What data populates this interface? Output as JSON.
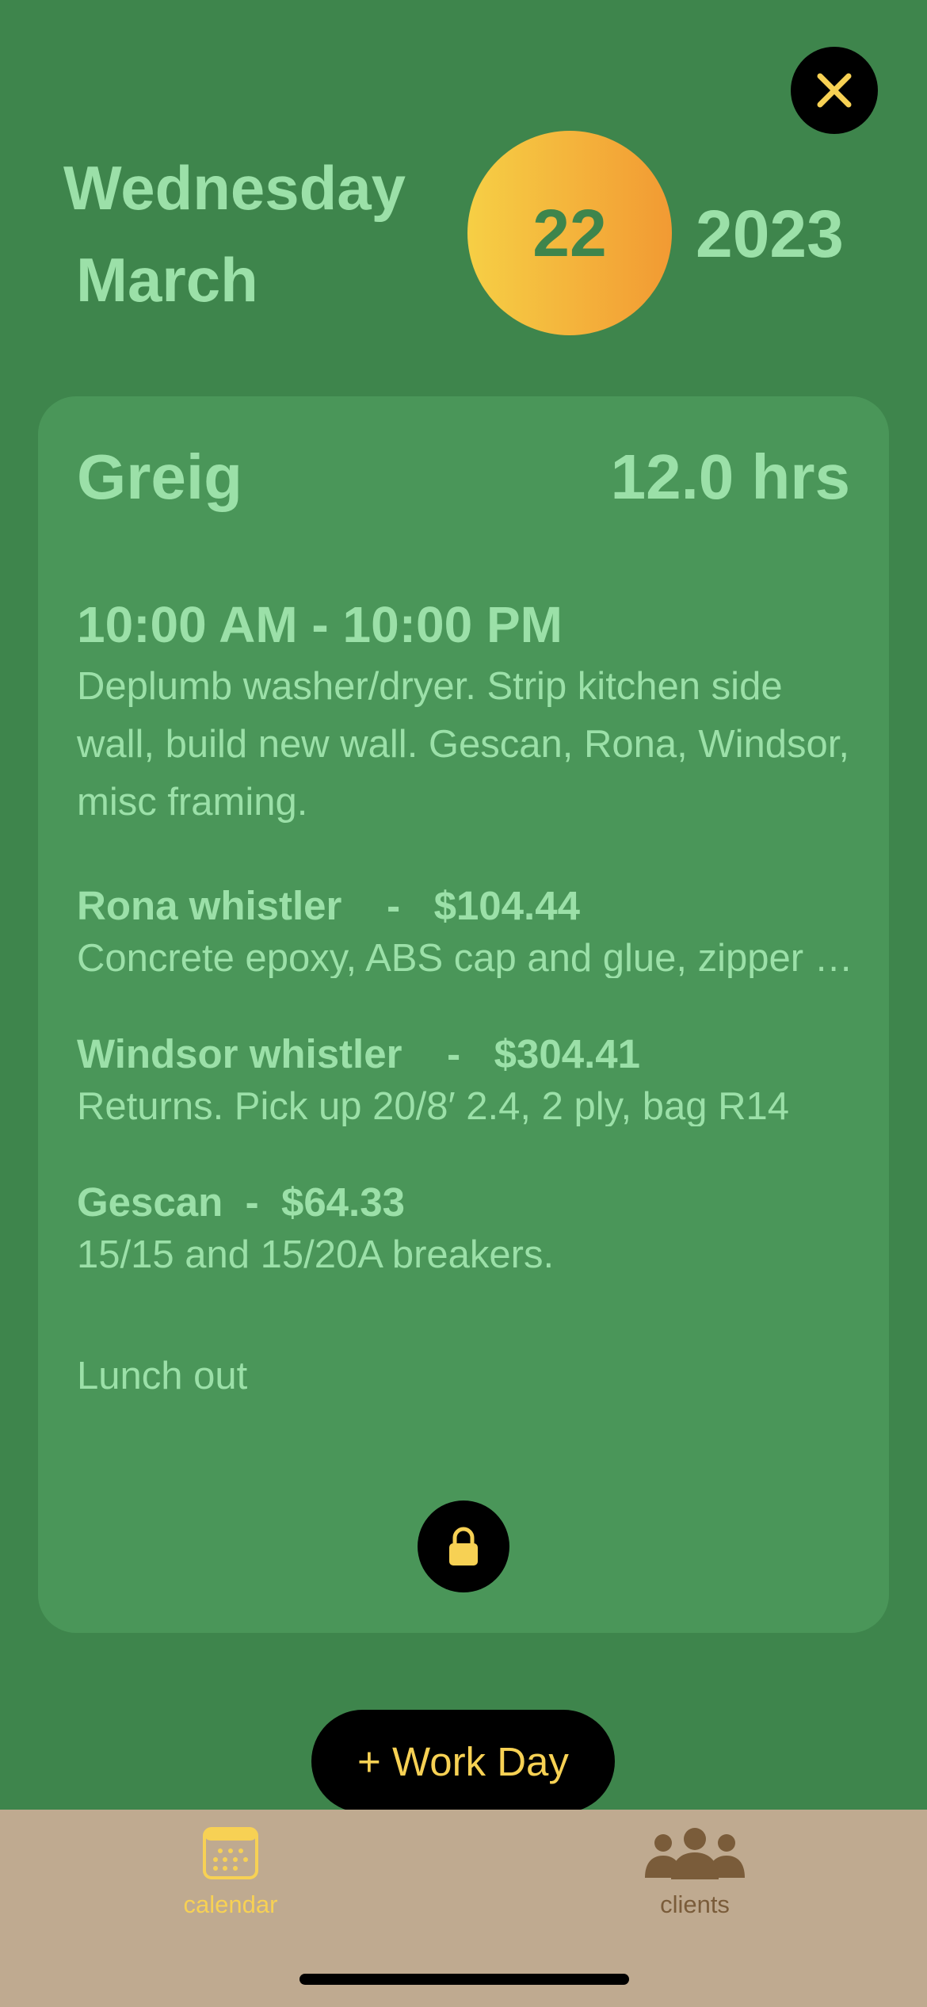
{
  "header": {
    "weekday": "Wednesday",
    "month": "March",
    "day": "22",
    "year": "2023",
    "close_icon": "close-icon"
  },
  "workday": {
    "client": "Greig",
    "hours": "12.0 hrs",
    "time_range": "10:00 AM - 10:00 PM",
    "description": "Deplumb washer/dryer. Strip kitchen side wall, build new wall. Gescan, Rona, Windsor, misc framing.",
    "expenses": [
      {
        "vendor": "Rona whistler",
        "separator": "-",
        "amount": "$104.44",
        "description": "Concrete epoxy, ABS cap and glue, zipper wall"
      },
      {
        "vendor": "Windsor whistler",
        "separator": "-",
        "amount": "$304.41",
        "description": "Returns. Pick up 20/8′ 2.4, 2 ply, bag R14"
      },
      {
        "vendor": "Gescan",
        "separator": "-",
        "amount": "$64.33",
        "description": "15/15 and 15/20A breakers."
      }
    ],
    "note": "Lunch out",
    "lock_icon": "lock-icon"
  },
  "actions": {
    "add_workday_label": "+ Work Day"
  },
  "tabbar": {
    "items": [
      {
        "label": "calendar",
        "icon": "calendar-icon",
        "active": true
      },
      {
        "label": "clients",
        "icon": "people-icon",
        "active": false
      }
    ]
  },
  "colors": {
    "background": "#3e854c",
    "card": "#4a9659",
    "text_green": "#9be0a8",
    "accent_yellow": "#f7d154",
    "tabbar": "#bfaa90",
    "inactive_tab": "#7a5c3a"
  }
}
